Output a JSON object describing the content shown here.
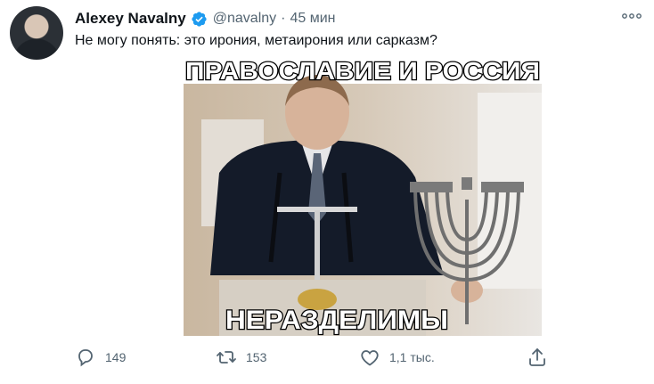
{
  "tweet": {
    "author_name": "Alexey Navalny",
    "handle": "@navalny",
    "separator": "·",
    "time": "45 мин",
    "text": "Не могу понять: это ирония, метаирония или сарказм?"
  },
  "media": {
    "top_caption": "ПРАВОСЛАВИЕ И РОССИЯ",
    "bottom_caption": "НЕРАЗДЕЛИМЫ"
  },
  "actions": {
    "reply_count": "149",
    "retweet_count": "153",
    "like_count": "1,1 тыс."
  },
  "colors": {
    "text_primary": "#0f1419",
    "text_secondary": "#536471",
    "verified_badge": "#1d9bf0"
  },
  "icons": [
    "more-icon",
    "verified-icon",
    "reply-icon",
    "retweet-icon",
    "like-icon",
    "share-icon"
  ]
}
